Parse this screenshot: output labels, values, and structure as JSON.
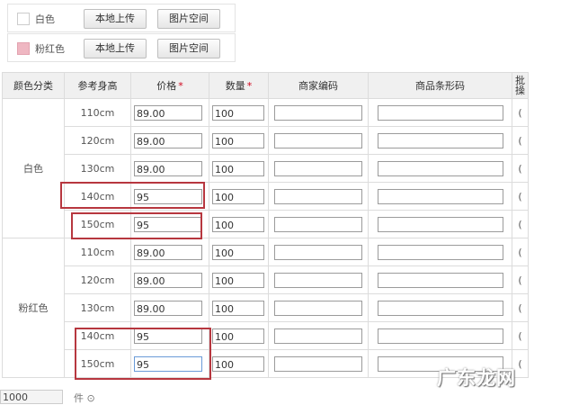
{
  "color_options": [
    {
      "label": "白色",
      "swatch": "#ffffff",
      "upload_label": "本地上传",
      "space_label": "图片空间"
    },
    {
      "label": "粉红色",
      "swatch": "#efb7c2",
      "upload_label": "本地上传",
      "space_label": "图片空间"
    }
  ],
  "table": {
    "headers": {
      "color": "颜色分类",
      "height": "参考身高",
      "price": "价格",
      "qty": "数量",
      "merchant_code": "商家编码",
      "barcode": "商品条形码",
      "edge": "批\n操"
    },
    "required_mark": "*",
    "groups": [
      {
        "color": "白色",
        "rows": [
          {
            "height": "110cm",
            "price": "89.00",
            "qty": "100"
          },
          {
            "height": "120cm",
            "price": "89.00",
            "qty": "100"
          },
          {
            "height": "130cm",
            "price": "89.00",
            "qty": "100"
          },
          {
            "height": "140cm",
            "price": "95",
            "qty": "100"
          },
          {
            "height": "150cm",
            "price": "95",
            "qty": "100"
          }
        ]
      },
      {
        "color": "粉红色",
        "rows": [
          {
            "height": "110cm",
            "price": "89.00",
            "qty": "100"
          },
          {
            "height": "120cm",
            "price": "89.00",
            "qty": "100"
          },
          {
            "height": "130cm",
            "price": "89.00",
            "qty": "100"
          },
          {
            "height": "140cm",
            "price": "95",
            "qty": "100"
          },
          {
            "height": "150cm",
            "price": "95",
            "qty": "100"
          }
        ]
      }
    ],
    "edge_char": "(",
    "highlight_color": "#b7373f"
  },
  "footer": {
    "total_qty": "1000",
    "unit": "件 ⊙"
  },
  "watermark": "广东龙网"
}
